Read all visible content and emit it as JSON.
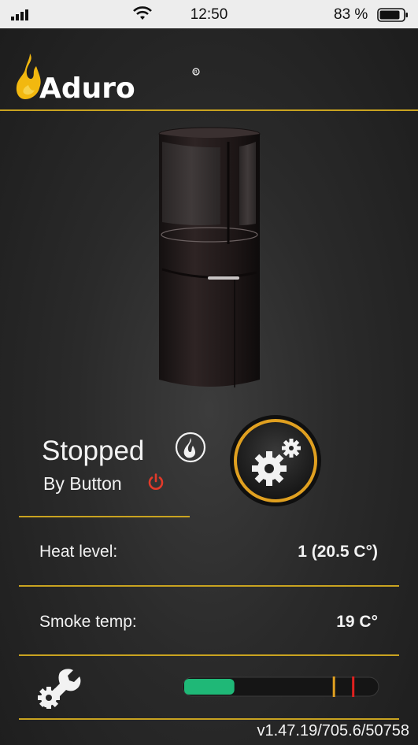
{
  "status_bar": {
    "time": "12:50",
    "battery": "83 %",
    "icons": [
      "signal-icon",
      "wifi-icon",
      "battery-icon"
    ]
  },
  "header": {
    "brand": "Aduro",
    "accent_color": "#c9a320",
    "flame_color": "#f2b80f"
  },
  "stove": {
    "state": "Stopped",
    "cause": "By Button"
  },
  "buttons": {
    "flame_icon": "flame-icon",
    "power_icon": "power-icon",
    "settings_icon": "gears-icon",
    "tools_icon": "tools-icon"
  },
  "readings": [
    {
      "label": "Heat level:",
      "value": "1 (20.5 C°)"
    },
    {
      "label": "Smoke temp:",
      "value": "19 C°"
    }
  ],
  "gauge": {
    "level": 0.26,
    "fill_color": "#1fb877",
    "markers": [
      {
        "at": 0.77,
        "color": "#e0a020"
      },
      {
        "at": 0.87,
        "color": "#e0201f"
      }
    ]
  },
  "footer": {
    "version": "v1.47.19/705.6/50758"
  }
}
